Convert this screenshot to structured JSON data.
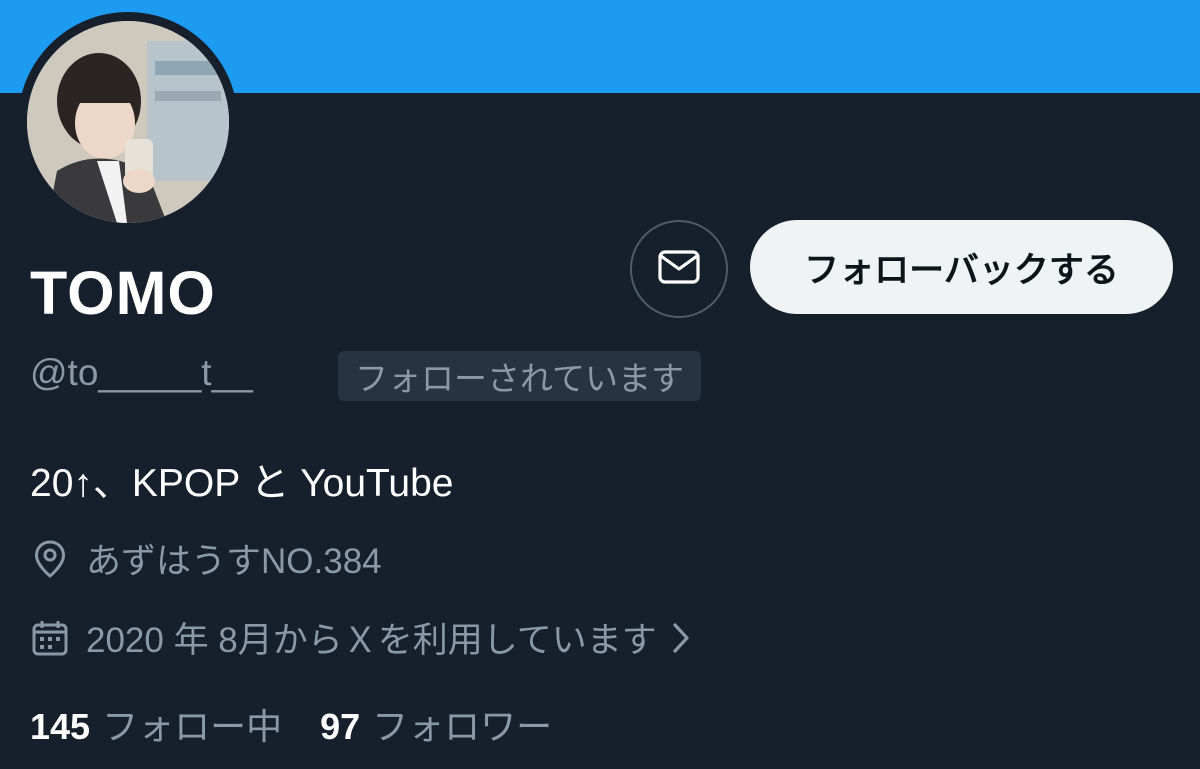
{
  "colors": {
    "banner": "#1d9bf0",
    "background": "#16202c",
    "primary_text": "#ffffff",
    "secondary_text": "#8b98a5",
    "button_bg": "#eff3f4",
    "button_text": "#0f1419",
    "badge_bg": "#263340"
  },
  "profile": {
    "display_name": "TOMO",
    "handle": "@to_____t__",
    "follows_you_badge": "フォローされています",
    "bio": "20↑、KPOP と YouTube",
    "location": "あずはうすNO.384",
    "location_icon": "location-pin-icon",
    "joined": "2020 年 8月からＸを利用しています",
    "joined_icon": "calendar-icon",
    "avatar_icon": "profile-photo"
  },
  "actions": {
    "message_icon": "mail-icon",
    "follow_back_label": "フォローバックする"
  },
  "stats": {
    "following_count": "145",
    "following_label": "フォロー中",
    "followers_count": "97",
    "followers_label": "フォロワー"
  }
}
